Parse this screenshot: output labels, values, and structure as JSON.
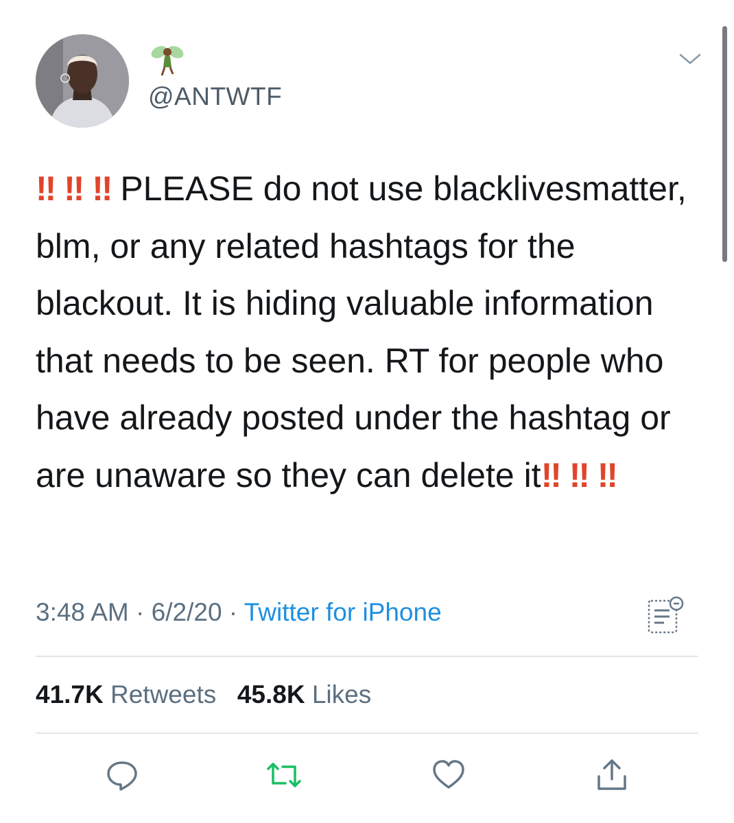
{
  "tweet": {
    "handle": "@ANTWTF",
    "text_line_1": " PLEASE do not use",
    "text_body": "blacklivesmatter, blm, or any related hashtags for the blackout. It is hiding valuable information that needs to be seen. RT for people who have already posted under the hashtag or are unaware so they can delete it",
    "time": "3:48 AM",
    "separator": " · ",
    "date": "6/2/20",
    "source": "Twitter for iPhone",
    "retweet_count": "41.7K",
    "retweet_label": " Retweets",
    "like_count": "45.8K",
    "like_label": " Likes",
    "bang_1": "‼",
    "bang_2": "‼",
    "bang_3": "‼",
    "bang_4": "‼",
    "bang_5": "‼",
    "bang_6": "‼"
  },
  "icons": {
    "name_emoji": "fairy-emoji-icon",
    "menu": "chevron-down-icon",
    "analytics": "analytics-icon",
    "reply": "reply-icon",
    "retweet": "retweet-icon",
    "like": "heart-icon",
    "share": "share-icon"
  },
  "colors": {
    "text": "#14171a",
    "secondary": "#5b6f80",
    "link": "#1d8fe0",
    "retweet_green": "#17bf63",
    "double_exclamation": "#e0452b",
    "divider": "#e3e6e9"
  }
}
